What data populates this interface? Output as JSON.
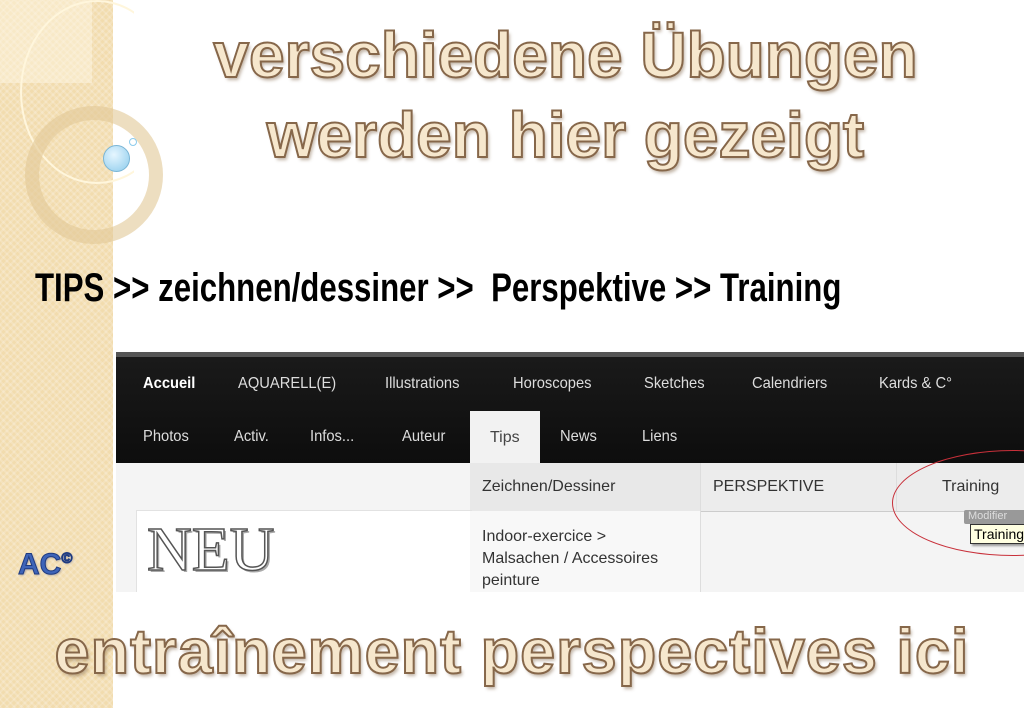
{
  "slide": {
    "title_line1": "verschiedene Übungen",
    "title_line2": "werden hier gezeigt",
    "breadcrumb": "TIPS >> zeichnen/dessiner >>  Perspektive >> Training",
    "bottom_text": "entraînement perspectives ici",
    "logo": {
      "text": "AC",
      "mark": "©"
    }
  },
  "website": {
    "nav_row1": [
      "Accueil",
      "AQUARELL(E)",
      "Illustrations",
      "Horoscopes",
      "Sketches",
      "Calendriers",
      "Kards & C°"
    ],
    "nav_row2": [
      "Photos",
      "Activ.",
      "Infos...",
      "Auteur",
      "Tips",
      "News",
      "Liens"
    ],
    "active_tab": "Tips",
    "submenu": {
      "level1": "Zeichnen/Dessiner",
      "level2": "PERSPEKTIVE",
      "level3": "Training",
      "item": "Indoor-exercice > Malsachen / Accessoires peinture"
    },
    "neu_label": "NEU",
    "modifier_label": "Modifier",
    "tooltip": "Training",
    "highlight_color": "#c8303a"
  }
}
